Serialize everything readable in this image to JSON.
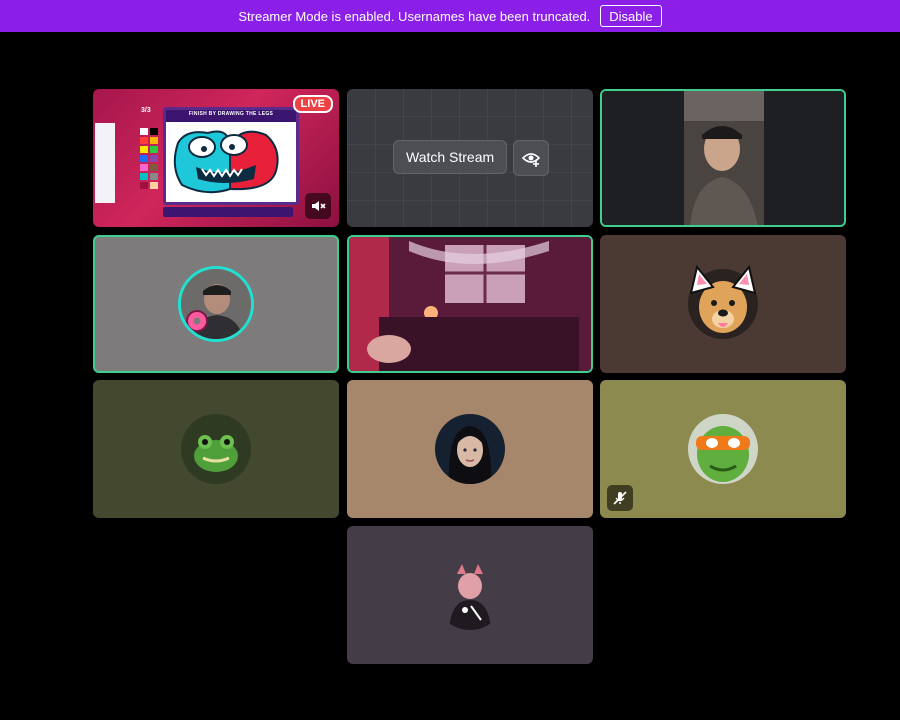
{
  "banner": {
    "message": "Streamer Mode is enabled. Usernames have been truncated.",
    "disable_label": "Disable"
  },
  "stream_tile": {
    "live_label": "LIVE",
    "game_title": "FINISH BY DRAWING THE LEGS",
    "counter": "3/3"
  },
  "watch_tile": {
    "watch_label": "Watch Stream"
  },
  "colors": {
    "banner": "#8b1fe8",
    "speaking_ring": "#3ecf8e",
    "live_red": "#ed4245",
    "tile_gray": "#7d7b7c",
    "tile_brown": "#4a3a33",
    "tile_olive_dark": "#43482f",
    "tile_tan": "#a6876b",
    "tile_olive": "#8c8a4f",
    "tile_purple_gray": "#443c47"
  },
  "icons": [
    "speaker-muted-icon",
    "eye-add-icon",
    "mic-muted-icon"
  ]
}
